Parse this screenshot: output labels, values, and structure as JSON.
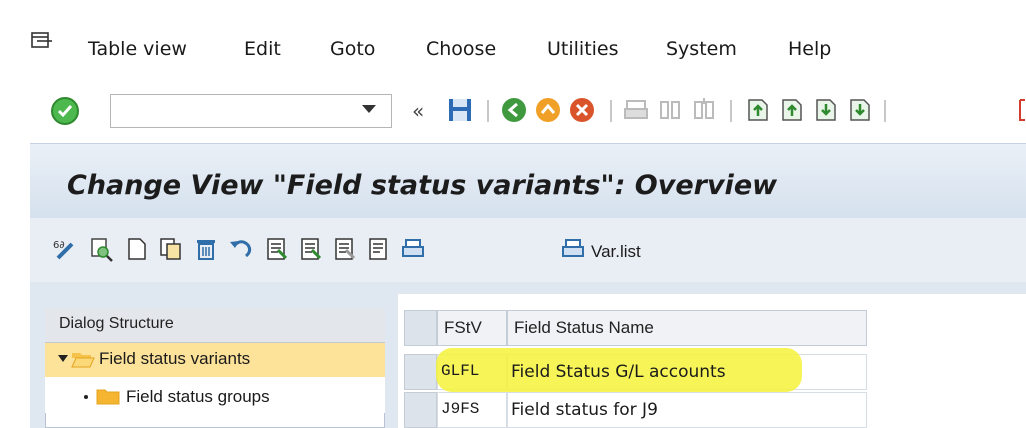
{
  "menubar": {
    "items": [
      "Table view",
      "Edit",
      "Goto",
      "Choose",
      "Utilities",
      "System",
      "Help"
    ]
  },
  "toolbar": {
    "command_field_value": ""
  },
  "title": "Change View \"Field status variants\": Overview",
  "app_toolbar": {
    "var_list_label": "Var.list"
  },
  "dialog_structure": {
    "header": "Dialog Structure",
    "items": [
      {
        "label": "Field status variants",
        "selected": true,
        "expanded": true
      },
      {
        "label": "Field status groups",
        "selected": false
      }
    ]
  },
  "table": {
    "columns": [
      "FStV",
      "Field Status Name"
    ],
    "rows": [
      {
        "code": "GLFL",
        "name": "Field Status G/L accounts",
        "highlighted": true
      },
      {
        "code": "J9FS",
        "name": "Field status for J9",
        "highlighted": false
      }
    ]
  },
  "colors": {
    "highlight": "#f4f23a",
    "tree_selected": "#fde29a",
    "title_bg": "#d5e1ee"
  }
}
